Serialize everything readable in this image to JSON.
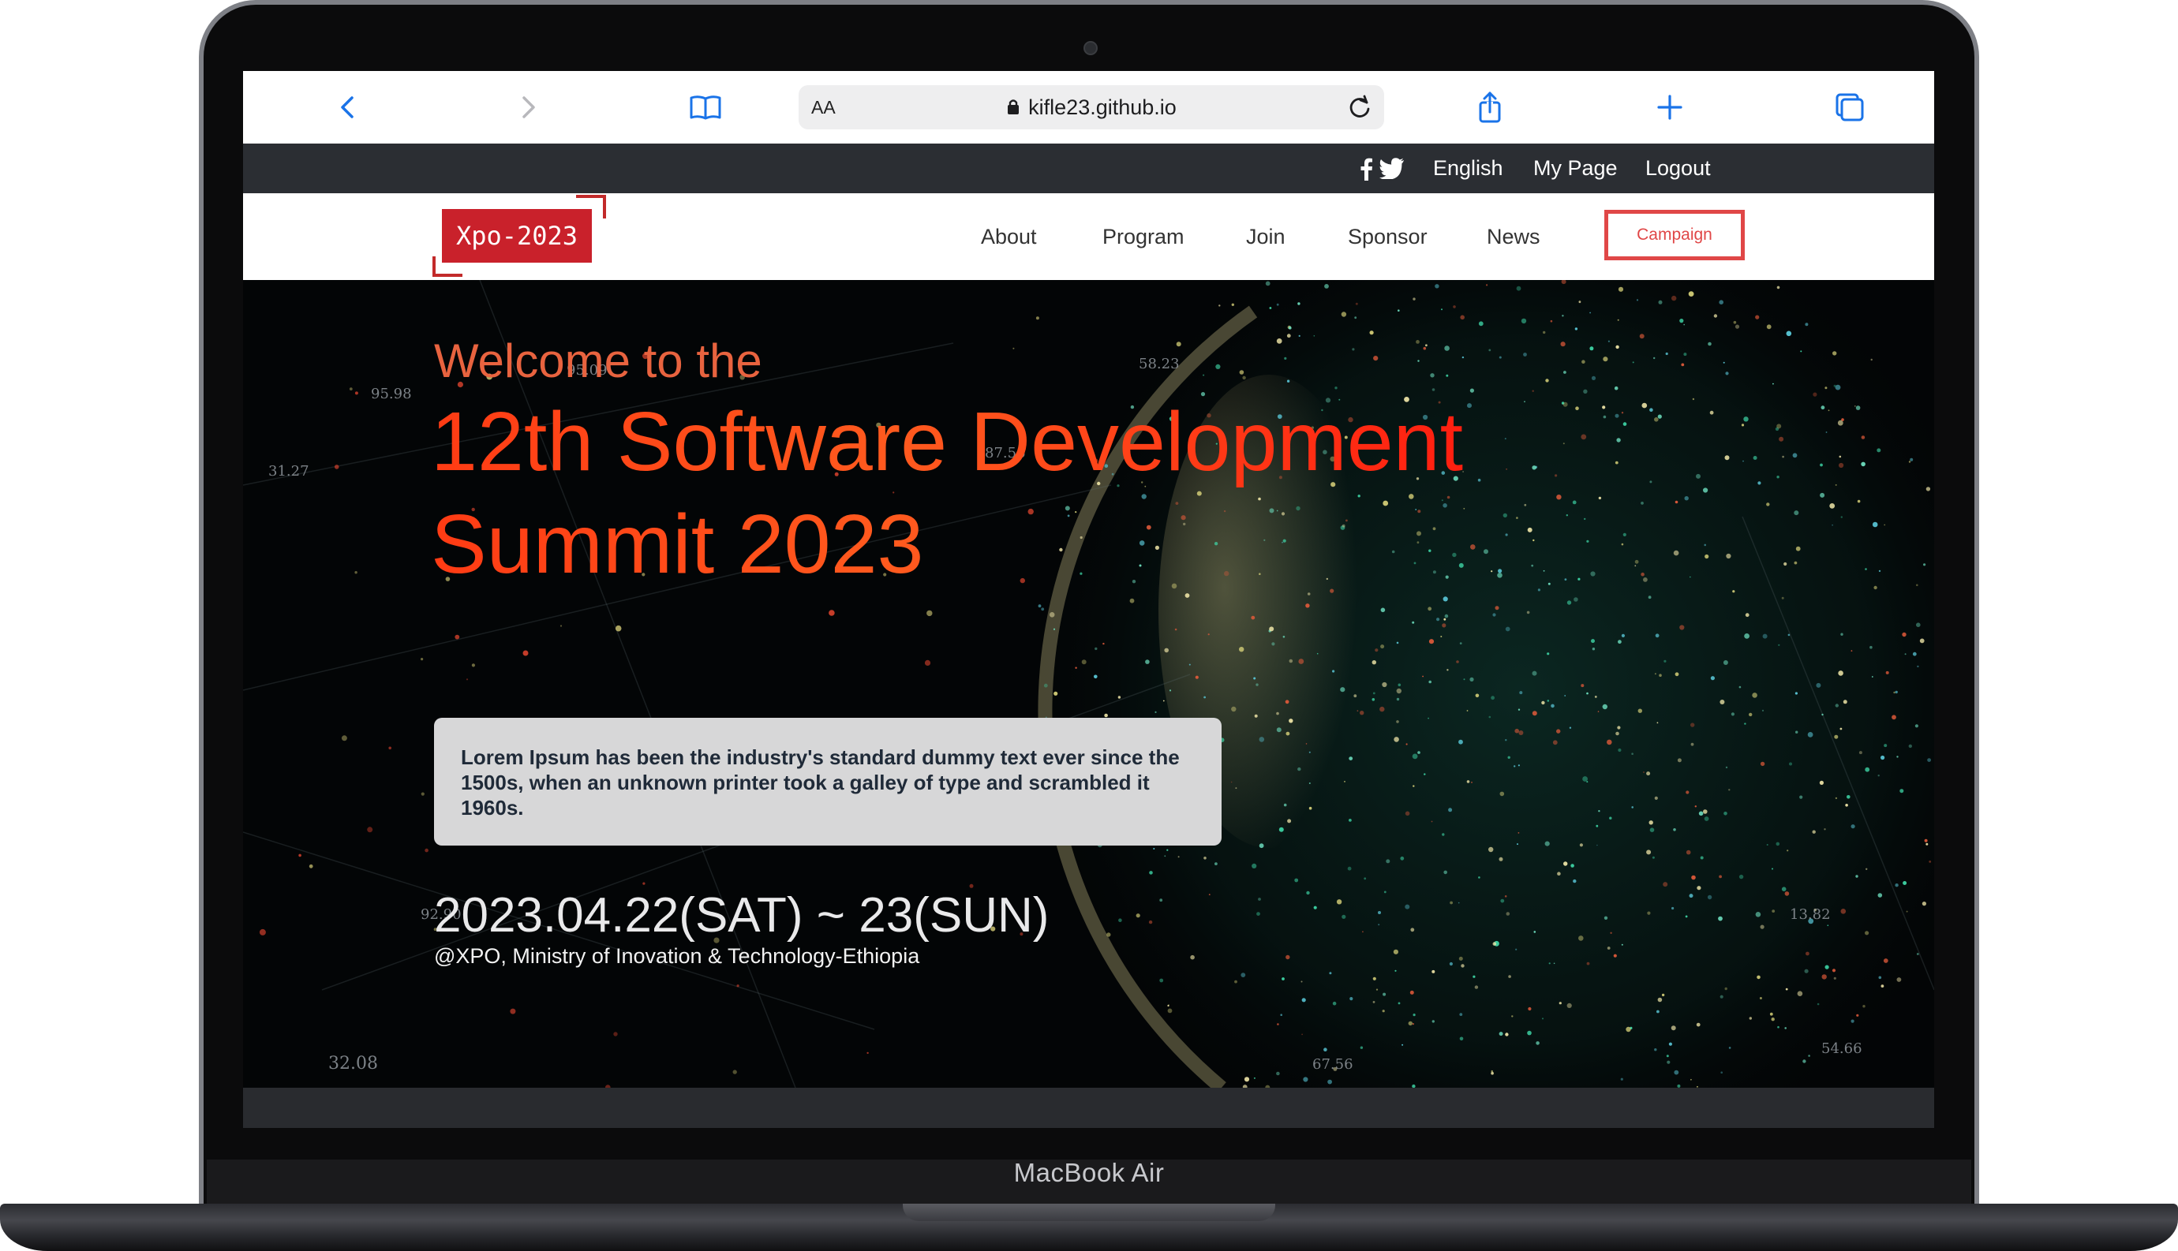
{
  "device": {
    "label": "MacBook Air"
  },
  "browser": {
    "text_size_label": "AA",
    "url": "kifle23.github.io",
    "icons": [
      "back-icon",
      "forward-icon",
      "bookmarks-icon",
      "lock-icon",
      "reload-icon",
      "share-icon",
      "new-tab-icon",
      "tabs-icon"
    ]
  },
  "topbar": {
    "social": [
      "facebook-icon",
      "twitter-icon"
    ],
    "language": "English",
    "my_page": "My Page",
    "logout": "Logout"
  },
  "nav": {
    "logo": "Xpo-2023",
    "items": [
      "About",
      "Program",
      "Join",
      "Sponsor",
      "News"
    ],
    "campaign": "Campaign"
  },
  "hero": {
    "welcome": "Welcome to the",
    "title_line1": "12th Software Development",
    "title_line2": "Summit 2023",
    "description": "Lorem Ipsum has been the industry's standard dummy text ever since the 1500s, when an unknown printer took a galley of type and scrambled it 1960s.",
    "date": "2023.04.22(SAT) ~ 23(SUN)",
    "venue": "@XPO, Ministry of Inovation & Technology-Ethiopia"
  },
  "colors": {
    "accent": "#e04747",
    "logo_bg": "#c9212b",
    "topbar_bg": "#2b2e33",
    "browser_blue": "#1a73e8"
  }
}
